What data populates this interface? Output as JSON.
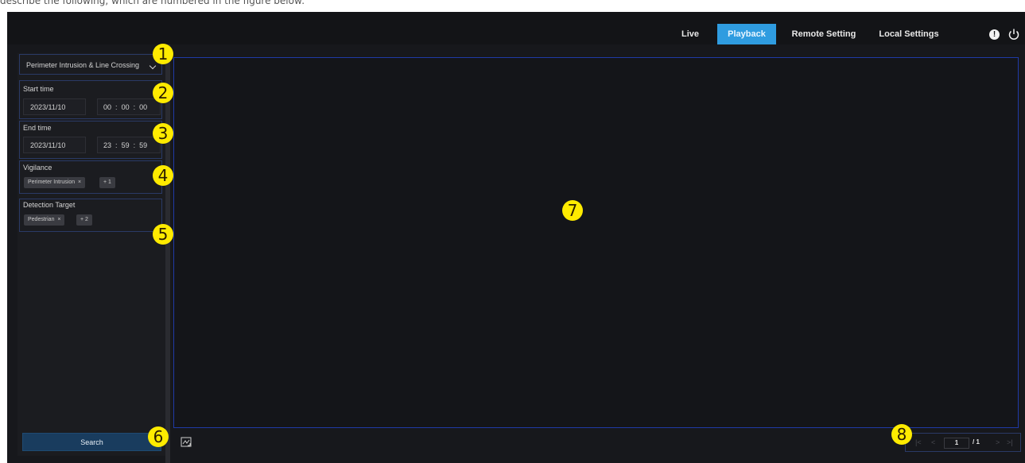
{
  "caption": "describe the following, which are numbered in the figure below:",
  "nav": {
    "tabs": [
      {
        "label": "Live"
      },
      {
        "label": "Playback"
      },
      {
        "label": "Remote Setting"
      },
      {
        "label": "Local Settings"
      }
    ],
    "active_tab": "Playback",
    "accent_color": "#2f9ce0",
    "icons": [
      "info-icon",
      "power-icon"
    ]
  },
  "sidebar": {
    "search_type": "Perimeter Intrusion & Line Crossing",
    "start_time": {
      "label": "Start time",
      "date": "2023/11/10",
      "hh": "00",
      "mm": "00",
      "ss": "00"
    },
    "end_time": {
      "label": "End time",
      "date": "2023/11/10",
      "hh": "23",
      "mm": "59",
      "ss": "59"
    },
    "time_sep": ":",
    "vigilance": {
      "label": "Vigilance",
      "tags": [
        "Perimeter Intrusion",
        "+ 1"
      ]
    },
    "detection_target": {
      "label": "Detection Target",
      "tags": [
        "Pedestrian",
        "+ 2"
      ]
    },
    "tag_close": "×",
    "search_button": "Search"
  },
  "pager": {
    "first": "|<",
    "prev": "<",
    "current": "1",
    "total": "/ 1",
    "next": ">",
    "last": ">|"
  },
  "callouts": [
    "1",
    "2",
    "3",
    "4",
    "5",
    "6",
    "7",
    "8"
  ]
}
